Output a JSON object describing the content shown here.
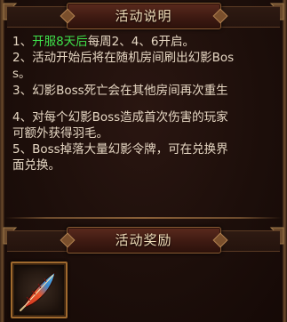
{
  "sections": {
    "description": {
      "title": "活动说明",
      "items": [
        {
          "prefix": "1、",
          "highlight": "开服8天后",
          "rest": "每周2、4、6开启。"
        },
        {
          "line1": "2、活动开始后将在随机房间刷出幻影Bos",
          "line2": "s。"
        },
        {
          "line1": "3、幻影Boss死亡会在其他房间再次重生"
        },
        {
          "line1": "4、对每个幻影Boss造成首次伤害的玩家",
          "line2": "可额外获得羽毛。"
        },
        {
          "line1": "5、Boss掉落大量幻影令牌，可在兑换界",
          "line2": "面兑换。"
        }
      ]
    },
    "reward": {
      "title": "活动奖励",
      "item_icon": "feather-icon"
    }
  },
  "colors": {
    "highlight": "#3ee04a",
    "text": "#e6d7c3",
    "title": "#efdcb8",
    "slot_border": "#a06a2e"
  }
}
